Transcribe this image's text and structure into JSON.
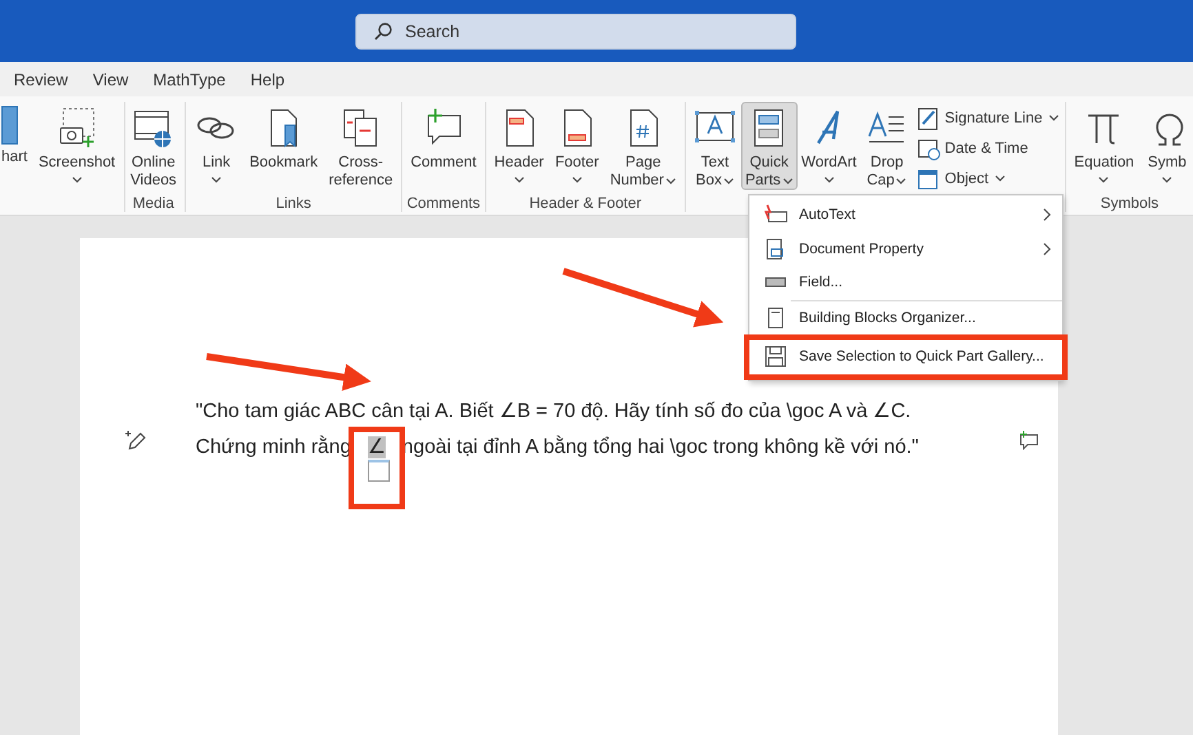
{
  "title_bar": {
    "search": {
      "placeholder": "Search"
    }
  },
  "menu_tabs": [
    {
      "label": "Review"
    },
    {
      "label": "View"
    },
    {
      "label": "MathType"
    },
    {
      "label": "Help"
    }
  ],
  "ribbon": {
    "groups": [
      {
        "buttons": [
          {
            "kind": "chart",
            "lines": [
              "hart"
            ],
            "dropdown": false,
            "selected": false
          },
          {
            "kind": "screenshot",
            "lines": [
              "Screenshot"
            ],
            "dropdown": true,
            "selected": false
          }
        ]
      },
      {
        "label": "Media",
        "buttons": [
          {
            "kind": "video",
            "lines": [
              "Online",
              "Videos"
            ],
            "dropdown": false,
            "selected": false
          }
        ]
      },
      {
        "label": "Links",
        "buttons": [
          {
            "kind": "link",
            "lines": [
              "Link"
            ],
            "dropdown": true,
            "selected": false
          },
          {
            "kind": "bookmark",
            "lines": [
              "Bookmark"
            ],
            "dropdown": false,
            "selected": false
          },
          {
            "kind": "crossref",
            "lines": [
              "Cross-",
              "reference"
            ],
            "dropdown": false,
            "selected": false
          }
        ]
      },
      {
        "label": "Comments",
        "buttons": [
          {
            "kind": "comment",
            "lines": [
              "Comment"
            ],
            "dropdown": false,
            "selected": false
          }
        ]
      },
      {
        "label": "Header & Footer",
        "buttons": [
          {
            "kind": "header",
            "lines": [
              "Header"
            ],
            "dropdown": true,
            "selected": false
          },
          {
            "kind": "footer",
            "lines": [
              "Footer"
            ],
            "dropdown": true,
            "selected": false
          },
          {
            "kind": "pagenumber",
            "lines": [
              "Page",
              "Number"
            ],
            "dropdown": true,
            "selected": false
          }
        ]
      },
      {
        "buttons": [
          {
            "kind": "textbox",
            "lines": [
              "Text",
              "Box"
            ],
            "dropdown": true,
            "selected": false
          },
          {
            "kind": "quickparts",
            "lines": [
              "Quick",
              "Parts"
            ],
            "dropdown": true,
            "selected": true
          },
          {
            "kind": "wordart",
            "lines": [
              "WordArt"
            ],
            "dropdown": true,
            "selected": false
          },
          {
            "kind": "dropcap",
            "lines": [
              "Drop",
              "Cap"
            ],
            "dropdown": true,
            "selected": false
          }
        ],
        "small_buttons": [
          {
            "kind": "signature",
            "label": "Signature Line",
            "dropdown": true
          },
          {
            "kind": "datetime",
            "label": "Date & Time",
            "dropdown": false
          },
          {
            "kind": "object",
            "label": "Object",
            "dropdown": true
          }
        ]
      },
      {
        "label": "Symbols",
        "buttons": [
          {
            "kind": "equation",
            "lines": [
              "Equation"
            ],
            "dropdown": true,
            "selected": false
          },
          {
            "kind": "symbol",
            "lines": [
              "Symb"
            ],
            "dropdown": true,
            "selected": false
          }
        ]
      }
    ]
  },
  "quick_parts_menu": [
    {
      "kind": "autotext",
      "label": "AutoText",
      "submenu": true
    },
    {
      "kind": "property",
      "label": "Document Property",
      "submenu": true
    },
    {
      "kind": "field",
      "label": "Field...",
      "submenu": false
    },
    {
      "kind": "organizer",
      "label": "Building Blocks Organizer...",
      "submenu": false
    },
    {
      "kind": "save",
      "label": "Save Selection to Quick Part Gallery...",
      "submenu": false
    }
  ],
  "document": {
    "text_before": "\"Cho tam giác ABC cân tại A. Biết ∠B = 70 độ. Hãy tính số đo của \\goc A và ∠C. Chứng minh rằng ",
    "selected_text": "∠",
    "text_after": " ngoài tại đỉnh A bằng tổng hai \\goc trong không kề với nó.\""
  }
}
